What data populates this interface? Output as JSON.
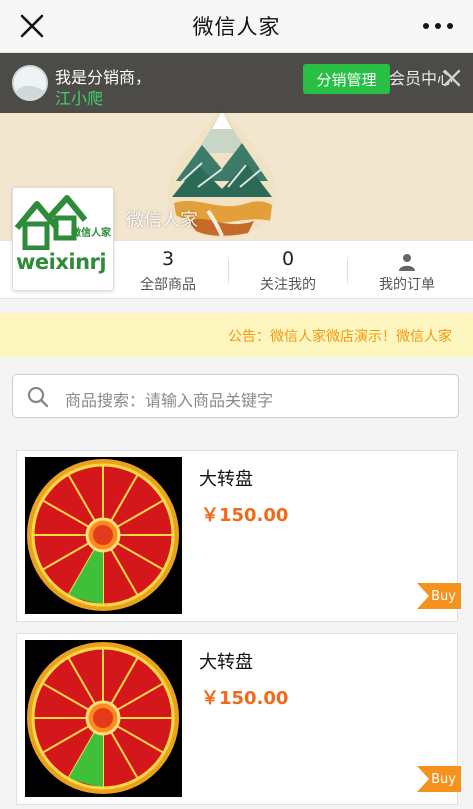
{
  "navbar": {
    "title": "微信人家",
    "close_icon": "close-icon",
    "more_icon": "more-dots-icon"
  },
  "distributor": {
    "greeting": "我是分销商，",
    "name": "江小爬",
    "manage_label": "分销管理",
    "member_center_label": "会员中心",
    "dismiss_icon": "close-icon"
  },
  "store": {
    "name": "微信人家",
    "logo_text": "weixinrj",
    "logo_subtext": "微信人家"
  },
  "stats": [
    {
      "value": "3",
      "label": "全部商品"
    },
    {
      "value": "0",
      "label": "关注我的"
    },
    {
      "icon": "user-icon",
      "label": "我的订单"
    }
  ],
  "announcement": {
    "text": "公告：微信人家微店演示！微信人家"
  },
  "search": {
    "placeholder": "商品搜索：请输入商品关键字"
  },
  "products": [
    {
      "name": "大转盘",
      "price": "￥150.00",
      "buy_label": "Buy"
    },
    {
      "name": "大转盘",
      "price": "￥150.00",
      "buy_label": "Buy"
    }
  ],
  "colors": {
    "accent_green": "#27c045",
    "price_orange": "#f06a1a",
    "buy_orange": "#f5921e",
    "announce_text": "#f39a12"
  }
}
